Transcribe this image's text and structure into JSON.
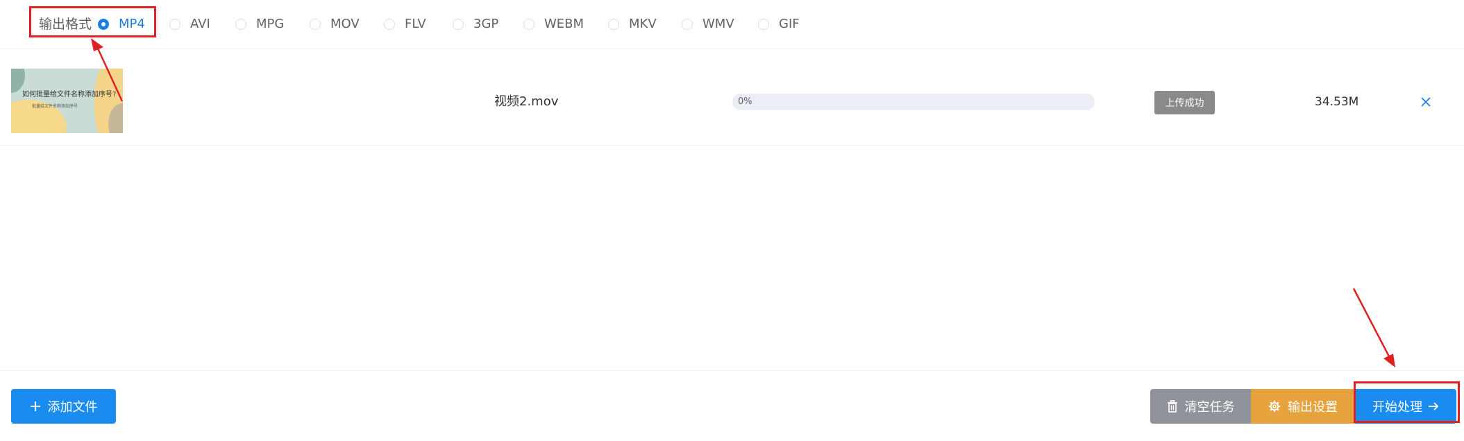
{
  "format_bar": {
    "label": "输出格式",
    "options": [
      {
        "label": "MP4",
        "checked": true
      },
      {
        "label": "AVI",
        "checked": false
      },
      {
        "label": "MPG",
        "checked": false
      },
      {
        "label": "MOV",
        "checked": false
      },
      {
        "label": "FLV",
        "checked": false
      },
      {
        "label": "3GP",
        "checked": false
      },
      {
        "label": "WEBM",
        "checked": false
      },
      {
        "label": "MKV",
        "checked": false
      },
      {
        "label": "WMV",
        "checked": false
      },
      {
        "label": "GIF",
        "checked": false
      }
    ]
  },
  "file": {
    "thumbnail_title": "如何批量给文件名称添加序号?",
    "thumbnail_subtitle": "批量给文件名称添加序号",
    "name": "视频2.mov",
    "progress_text": "0%",
    "progress_value": 0,
    "status": "上传成功",
    "size": "34.53M"
  },
  "footer": {
    "add_label": "添加文件",
    "clear_label": "清空任务",
    "settings_label": "输出设置",
    "start_label": "开始处理"
  },
  "colors": {
    "primary": "#1a8cf0",
    "selected_radio": "#1a7ee6",
    "clear_button": "#909399",
    "settings_button": "#e6a23c",
    "status_badge": "#8a8a8a",
    "annotation": "#e02020"
  },
  "icons": {
    "add": "plus-icon",
    "clear": "trash-icon",
    "settings": "gear-icon",
    "start": "arrow-right-icon",
    "remove": "close-icon"
  }
}
